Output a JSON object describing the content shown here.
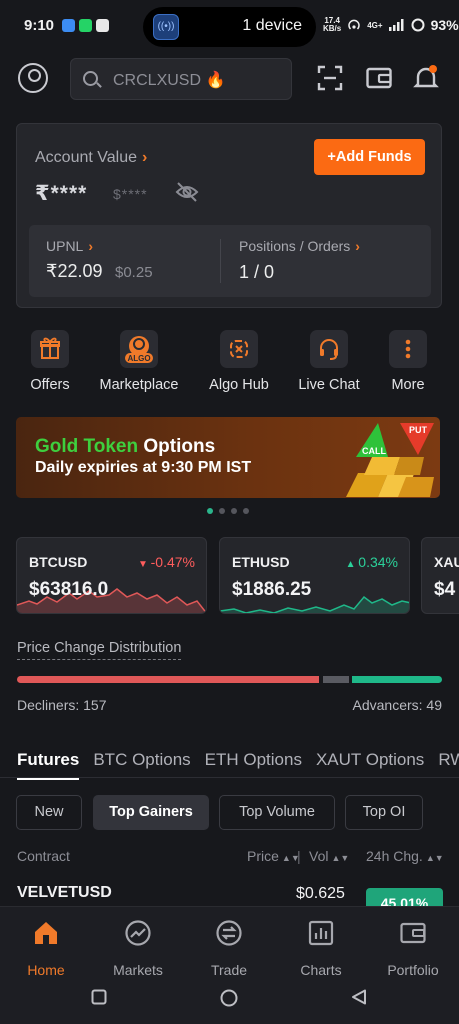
{
  "status_bar": {
    "time": "9:10",
    "island_text": "1 device",
    "speed_value": "17.4",
    "speed_unit": "KB/s",
    "network": "4G+",
    "battery": "93%"
  },
  "search": {
    "placeholder": "CRCLXUSD 🔥"
  },
  "account": {
    "label": "Account Value",
    "value_masked": "₹****",
    "usd_masked": "$****",
    "add_funds": "+Add Funds",
    "upnl_label": "UPNL",
    "upnl_value": "₹22.09",
    "upnl_usd": "$0.25",
    "positions_label": "Positions / Orders",
    "positions_value": "1 / 0"
  },
  "quick_actions": [
    {
      "label": "Offers",
      "icon": "gift-icon"
    },
    {
      "label": "Marketplace",
      "icon": "algo-icon",
      "badge": "ALGO"
    },
    {
      "label": "Algo Hub",
      "icon": "algo-hub-icon"
    },
    {
      "label": "Live Chat",
      "icon": "headset-icon"
    },
    {
      "label": "More",
      "icon": "more-icon"
    }
  ],
  "banner": {
    "title_a": "Gold Token ",
    "title_b": "Options",
    "subtitle": "Daily expiries at 9:30 PM IST",
    "call": "CALL",
    "put": "PUT",
    "colors": {
      "accent": "#3ecf3e"
    }
  },
  "carousel": {
    "count": 4,
    "active": 0
  },
  "tickers": [
    {
      "symbol": "BTCUSD",
      "change": "-0.47%",
      "direction": "down",
      "price": "$63816.0"
    },
    {
      "symbol": "ETHUSD",
      "change": "0.34%",
      "direction": "up",
      "price": "$1886.25"
    },
    {
      "symbol": "XAU",
      "change": "",
      "direction": "up",
      "price": "$4"
    }
  ],
  "distribution": {
    "title": "Price Change Distribution",
    "decliners_label": "Decliners: 157",
    "advancers_label": "Advancers: 49",
    "decliners": 157,
    "advancers": 49
  },
  "tabs": [
    "Futures",
    "BTC Options",
    "ETH Options",
    "XAUT Options",
    "RWA"
  ],
  "chips": [
    "New",
    "Top Gainers",
    "Top Volume",
    "Top OI"
  ],
  "table": {
    "col_contract": "Contract",
    "col_price": "Price",
    "col_vol": "Vol",
    "col_change": "24h Chg.",
    "rows": [
      {
        "contract": "VELVETUSD",
        "price": "$0.625",
        "change": "45.01%"
      }
    ]
  },
  "bottom_nav": [
    {
      "label": "Home",
      "active": true
    },
    {
      "label": "Markets"
    },
    {
      "label": "Trade"
    },
    {
      "label": "Charts"
    },
    {
      "label": "Portfolio"
    }
  ],
  "colors": {
    "accent": "#fb6a13",
    "up": "#2bd19a",
    "down": "#ff5d5d",
    "background": "#17181c"
  }
}
